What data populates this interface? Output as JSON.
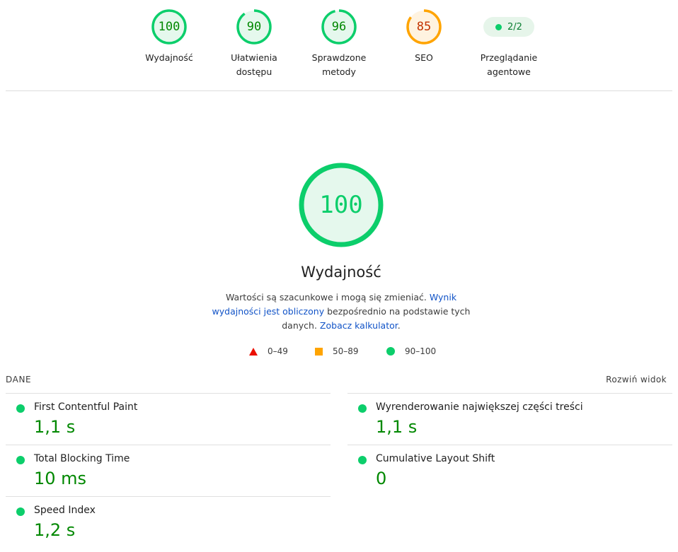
{
  "summary": {
    "gauges": [
      {
        "score": "100",
        "label_line1": "Wydajność",
        "label_line2": "",
        "color": "#0cce6b",
        "text_color": "#008800",
        "fill": "#e5f8ed",
        "fraction": 1.0
      },
      {
        "score": "90",
        "label_line1": "Ułatwienia",
        "label_line2": "dostępu",
        "color": "#0cce6b",
        "text_color": "#008800",
        "fill": "#e5f8ed",
        "fraction": 0.9
      },
      {
        "score": "96",
        "label_line1": "Sprawdzone",
        "label_line2": "metody",
        "color": "#0cce6b",
        "text_color": "#008800",
        "fill": "#e5f8ed",
        "fraction": 0.96
      },
      {
        "score": "85",
        "label_line1": "SEO",
        "label_line2": "",
        "color": "#ffa400",
        "text_color": "#c33300",
        "fill": "#fff3e0",
        "fraction": 0.85
      }
    ],
    "agentic": {
      "value": "2/2",
      "label_line1": "Przeglądanie",
      "label_line2": "agentowe"
    }
  },
  "performance": {
    "score": "100",
    "fraction": 1.0,
    "title": "Wydajność",
    "desc_text1": "Wartości są szacunkowe i mogą się zmieniać.",
    "desc_link1": "Wynik wydajności jest obliczony",
    "desc_text2": "bezpośrednio na podstawie tych danych.",
    "desc_link2": "Zobacz kalkulator",
    "desc_text3": "."
  },
  "legend": {
    "fail": "0–49",
    "average": "50–89",
    "pass": "90–100"
  },
  "metrics": {
    "header": "DANE",
    "expand": "Rozwiń widok",
    "left": [
      {
        "title": "First Contentful Paint",
        "value": "1,1 s"
      },
      {
        "title": "Total Blocking Time",
        "value": "10 ms"
      },
      {
        "title": "Speed Index",
        "value": "1,2 s"
      }
    ],
    "right": [
      {
        "title": "Wyrenderowanie największej części treści",
        "value": "1,1 s"
      },
      {
        "title": "Cumulative Layout Shift",
        "value": "0"
      }
    ]
  },
  "colors": {
    "pass": "#0cce6b",
    "average": "#ffa400",
    "fail": "#eb0f00",
    "link": "#1153c7"
  }
}
